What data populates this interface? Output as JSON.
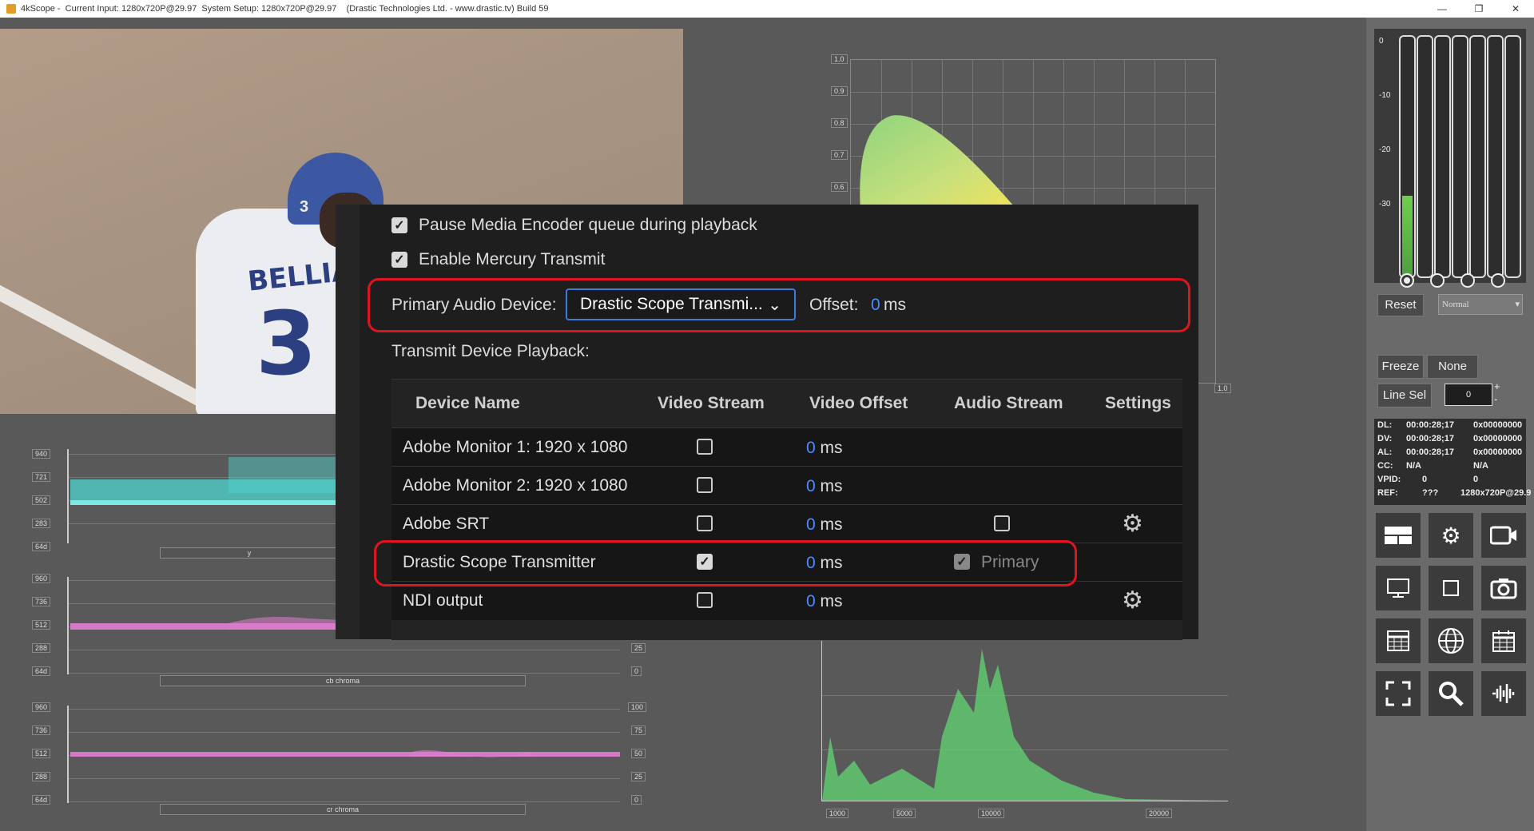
{
  "window": {
    "title": "4kScope -  Current Input: 1280x720P@29.97  System Setup: 1280x720P@29.97    (Drastic Technologies Ltd. - www.drastic.tv) Build 59",
    "controls": [
      "—",
      "❐",
      "✕"
    ]
  },
  "video": {
    "jersey_text": "BELLIA",
    "jersey_number": "3",
    "helmet_number": "3"
  },
  "gamut": {
    "y_ticks": [
      "1.0",
      "0.9",
      "0.8",
      "0.7",
      "0.6"
    ],
    "x_end": "1.0"
  },
  "waveform_y": {
    "ticks": [
      "940",
      "721",
      "502",
      "283",
      "64d"
    ],
    "label": "y"
  },
  "waveform_cb": {
    "ticks": [
      "960",
      "736",
      "512",
      "288",
      "64d"
    ],
    "right_ticks": [
      "25",
      "0"
    ],
    "label": "cb chroma"
  },
  "waveform_cr": {
    "ticks": [
      "960",
      "736",
      "512",
      "288",
      "64d"
    ],
    "right_ticks": [
      "100",
      "75",
      "50",
      "25",
      "0"
    ],
    "label": "cr chroma"
  },
  "histogram": {
    "x_ticks": [
      "1000",
      "5000",
      "10000",
      "20000"
    ]
  },
  "audio_meter": {
    "labels": [
      "0",
      "-10",
      "-20",
      "-30"
    ],
    "levels": [
      0.33,
      0,
      0,
      0
    ]
  },
  "controls": {
    "reset": "Reset",
    "mode": "Normal",
    "freeze": "Freeze",
    "none": "None",
    "line_sel": "Line Sel",
    "line_value": "0",
    "spin_up": "+",
    "spin_down": "-"
  },
  "timecodes": [
    {
      "k": "DL:",
      "tc": "00:00:28;17",
      "v": "0x00000000"
    },
    {
      "k": "DV:",
      "tc": "00:00:28;17",
      "v": "0x00000000"
    },
    {
      "k": "AL:",
      "tc": "00:00:28;17",
      "v": "0x00000000"
    },
    {
      "k": "CC:",
      "tc": "N/A",
      "v": "N/A"
    },
    {
      "k": "VPID:",
      "tc": "0",
      "v": "0"
    },
    {
      "k": "REF:",
      "tc": "???",
      "v": "1280x720P@29.9"
    }
  ],
  "icons": {
    "row1": [
      "layout-icon",
      "gear-icon",
      "cast-icon"
    ],
    "row2": [
      "monitor-icon",
      "square-icon",
      "camera-icon"
    ],
    "row3": [
      "table-icon",
      "globe-icon",
      "calendar-icon"
    ],
    "row4": [
      "fullscreen-icon",
      "zoom-icon",
      "waveform-icon"
    ]
  },
  "dialog": {
    "pause_label": "Pause Media Encoder queue during playback",
    "mercury_label": "Enable Mercury Transmit",
    "primary_audio_label": "Primary Audio Device:",
    "primary_audio_value": "Drastic Scope Transmi...",
    "offset_label": "Offset:",
    "offset_value": "0",
    "offset_unit": "ms",
    "transmit_label": "Transmit Device Playback:",
    "headers": {
      "device": "Device Name",
      "video": "Video Stream",
      "voffset": "Video Offset",
      "audio": "Audio Stream",
      "settings": "Settings"
    },
    "devices": [
      {
        "name": "Adobe Monitor 1: 1920 x 1080",
        "offset": "0",
        "unit": "ms"
      },
      {
        "name": "Adobe Monitor 2: 1920 x 1080",
        "offset": "0",
        "unit": "ms"
      },
      {
        "name": "Adobe SRT",
        "offset": "0",
        "unit": "ms"
      },
      {
        "name": "Drastic Scope Transmitter",
        "offset": "0",
        "unit": "ms",
        "primary": "Primary"
      },
      {
        "name": "NDI output",
        "offset": "0",
        "unit": "ms"
      }
    ]
  }
}
